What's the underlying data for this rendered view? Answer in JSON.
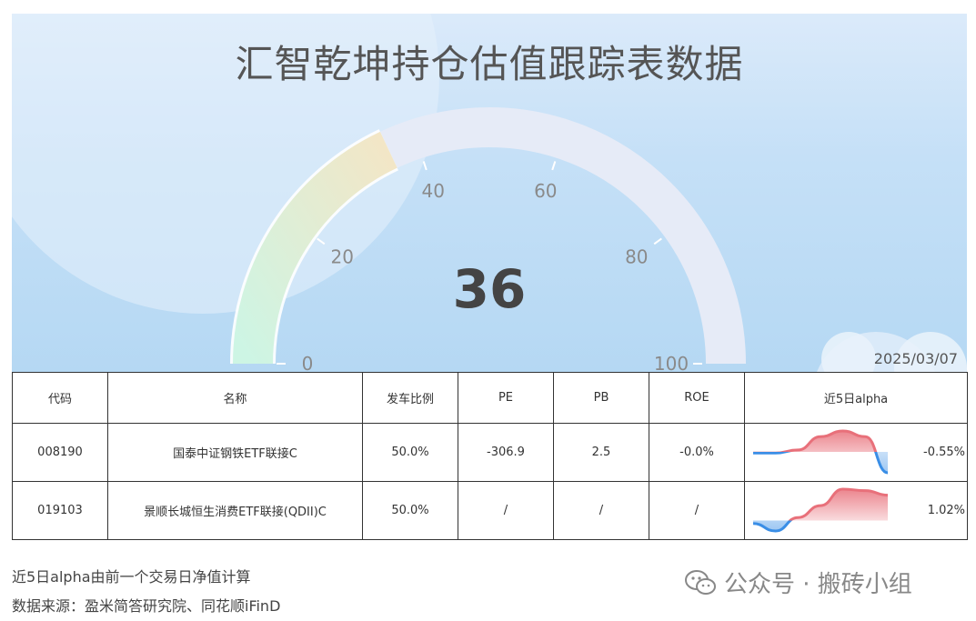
{
  "title": "汇智乾坤持仓估值跟踪表数据",
  "gauge": {
    "value": 36,
    "value_label": "36",
    "min": 0,
    "max": 100,
    "ticks": [
      "0",
      "20",
      "40",
      "60",
      "80",
      "100"
    ]
  },
  "date": "2025/03/07",
  "table": {
    "headers": [
      "代码",
      "名称",
      "发车比例",
      "PE",
      "PB",
      "ROE",
      "近5日alpha"
    ],
    "rows": [
      {
        "code": "008190",
        "name": "国泰中证钢铁ETF联接C",
        "ratio": "50.0%",
        "pe": "-306.9",
        "pb": "2.5",
        "roe": "-0.0%",
        "alpha": "-0.55%",
        "spark": [
          -0.03,
          -0.03,
          0.05,
          0.4,
          0.55,
          0.4,
          -0.55
        ]
      },
      {
        "code": "019103",
        "name": "景顺长城恒生消费ETF联接(QDII)C",
        "ratio": "50.0%",
        "pe": "/",
        "pb": "/",
        "roe": "/",
        "alpha": "1.02%",
        "spark": [
          -0.1,
          -0.35,
          0.1,
          0.5,
          1.05,
          1.0,
          0.85
        ]
      }
    ]
  },
  "notes": [
    "近5日alpha由前一个交易日净值计算",
    "数据来源：盈米简答研究院、同花顺iFinD"
  ],
  "watermark": {
    "text": "公众号 · 搬砖小组",
    "icon": "wechat-icon"
  },
  "colors": {
    "gauge_track": "#e6ebf7",
    "spark_pos": "#e8707a",
    "spark_neg": "#3a8ee6"
  }
}
